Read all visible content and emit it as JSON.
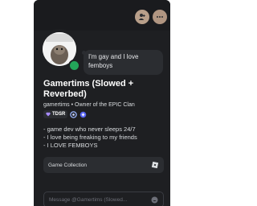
{
  "profile": {
    "display_name": "Gamertims (Slowed + Reverbed)",
    "username": "gamertims",
    "separator": "•",
    "pronouns_line": "Owner of the EPIC Clan",
    "status_text": "I'm gay and I love femboys",
    "tag": "TDSR",
    "bio_lines": [
      "- game dev who never sleeps 24/7",
      "- I love being freaking to my friends",
      "- I LOVE FEMBOYS"
    ]
  },
  "connections": {
    "game_collection_label": "Game Collection",
    "game_icon": "roblox-icon"
  },
  "message": {
    "placeholder": "Message @Gamertims (Slowed..."
  },
  "header": {
    "add_friend_icon": "add-friend-icon",
    "more_icon": "more-icon"
  },
  "colors": {
    "card_bg": "#1e1f22",
    "panel_bg": "#2b2d31",
    "online": "#23a55a",
    "header_button": "#b39a85"
  }
}
